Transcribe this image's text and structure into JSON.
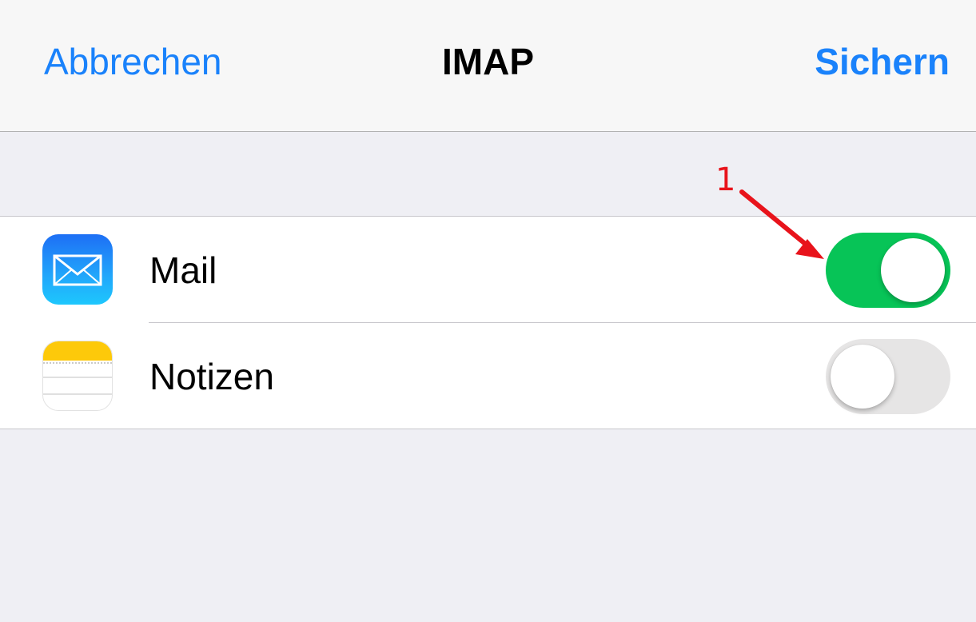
{
  "navbar": {
    "cancel_label": "Abbrechen",
    "title": "IMAP",
    "save_label": "Sichern"
  },
  "rows": [
    {
      "label": "Mail",
      "icon": "mail-app-icon",
      "enabled": true
    },
    {
      "label": "Notizen",
      "icon": "notes-app-icon",
      "enabled": false
    }
  ],
  "annotation": {
    "number": "1",
    "color": "#e8131b"
  },
  "colors": {
    "accent": "#1a82fb",
    "toggle_on": "#07c457",
    "toggle_off": "#e6e5e5",
    "background": "#efeff4"
  }
}
